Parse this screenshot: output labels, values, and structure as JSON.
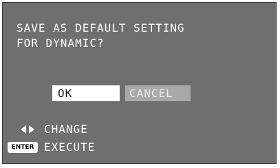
{
  "dialog": {
    "message_line1": "SAVE AS DEFAULT SETTING",
    "message_line2": "FOR DYNAMIC?"
  },
  "buttons": {
    "ok_label": "OK",
    "cancel_label": "CANCEL",
    "selected": "OK"
  },
  "hints": {
    "change": {
      "icon": "left-right-arrows-icon",
      "label": "CHANGE"
    },
    "execute": {
      "badge": "ENTER",
      "label": "EXECUTE"
    }
  },
  "colors": {
    "dialog_bg": "#6f6f6f",
    "selected_button": "#ffffff",
    "unselected_button": "#a9a9a9",
    "text": "#ffffff"
  }
}
